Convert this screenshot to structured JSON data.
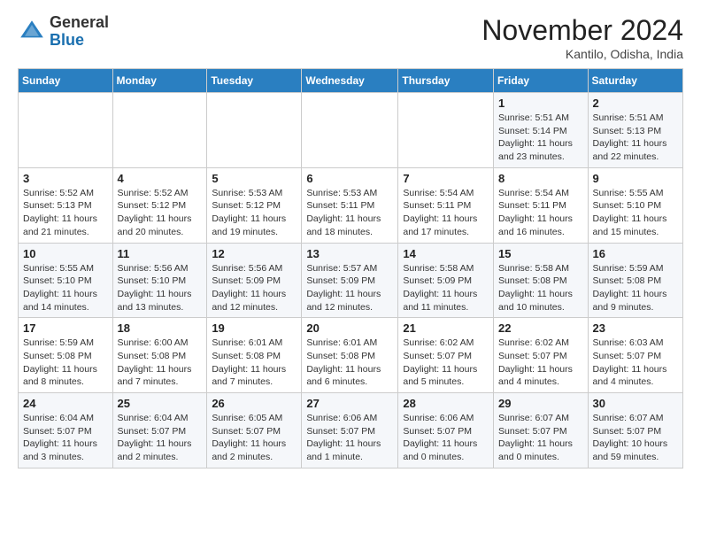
{
  "header": {
    "logo_general": "General",
    "logo_blue": "Blue",
    "month_title": "November 2024",
    "location": "Kantilo, Odisha, India"
  },
  "weekdays": [
    "Sunday",
    "Monday",
    "Tuesday",
    "Wednesday",
    "Thursday",
    "Friday",
    "Saturday"
  ],
  "weeks": [
    [
      {
        "day": "",
        "info": ""
      },
      {
        "day": "",
        "info": ""
      },
      {
        "day": "",
        "info": ""
      },
      {
        "day": "",
        "info": ""
      },
      {
        "day": "",
        "info": ""
      },
      {
        "day": "1",
        "info": "Sunrise: 5:51 AM\nSunset: 5:14 PM\nDaylight: 11 hours\nand 23 minutes."
      },
      {
        "day": "2",
        "info": "Sunrise: 5:51 AM\nSunset: 5:13 PM\nDaylight: 11 hours\nand 22 minutes."
      }
    ],
    [
      {
        "day": "3",
        "info": "Sunrise: 5:52 AM\nSunset: 5:13 PM\nDaylight: 11 hours\nand 21 minutes."
      },
      {
        "day": "4",
        "info": "Sunrise: 5:52 AM\nSunset: 5:12 PM\nDaylight: 11 hours\nand 20 minutes."
      },
      {
        "day": "5",
        "info": "Sunrise: 5:53 AM\nSunset: 5:12 PM\nDaylight: 11 hours\nand 19 minutes."
      },
      {
        "day": "6",
        "info": "Sunrise: 5:53 AM\nSunset: 5:11 PM\nDaylight: 11 hours\nand 18 minutes."
      },
      {
        "day": "7",
        "info": "Sunrise: 5:54 AM\nSunset: 5:11 PM\nDaylight: 11 hours\nand 17 minutes."
      },
      {
        "day": "8",
        "info": "Sunrise: 5:54 AM\nSunset: 5:11 PM\nDaylight: 11 hours\nand 16 minutes."
      },
      {
        "day": "9",
        "info": "Sunrise: 5:55 AM\nSunset: 5:10 PM\nDaylight: 11 hours\nand 15 minutes."
      }
    ],
    [
      {
        "day": "10",
        "info": "Sunrise: 5:55 AM\nSunset: 5:10 PM\nDaylight: 11 hours\nand 14 minutes."
      },
      {
        "day": "11",
        "info": "Sunrise: 5:56 AM\nSunset: 5:10 PM\nDaylight: 11 hours\nand 13 minutes."
      },
      {
        "day": "12",
        "info": "Sunrise: 5:56 AM\nSunset: 5:09 PM\nDaylight: 11 hours\nand 12 minutes."
      },
      {
        "day": "13",
        "info": "Sunrise: 5:57 AM\nSunset: 5:09 PM\nDaylight: 11 hours\nand 12 minutes."
      },
      {
        "day": "14",
        "info": "Sunrise: 5:58 AM\nSunset: 5:09 PM\nDaylight: 11 hours\nand 11 minutes."
      },
      {
        "day": "15",
        "info": "Sunrise: 5:58 AM\nSunset: 5:08 PM\nDaylight: 11 hours\nand 10 minutes."
      },
      {
        "day": "16",
        "info": "Sunrise: 5:59 AM\nSunset: 5:08 PM\nDaylight: 11 hours\nand 9 minutes."
      }
    ],
    [
      {
        "day": "17",
        "info": "Sunrise: 5:59 AM\nSunset: 5:08 PM\nDaylight: 11 hours\nand 8 minutes."
      },
      {
        "day": "18",
        "info": "Sunrise: 6:00 AM\nSunset: 5:08 PM\nDaylight: 11 hours\nand 7 minutes."
      },
      {
        "day": "19",
        "info": "Sunrise: 6:01 AM\nSunset: 5:08 PM\nDaylight: 11 hours\nand 7 minutes."
      },
      {
        "day": "20",
        "info": "Sunrise: 6:01 AM\nSunset: 5:08 PM\nDaylight: 11 hours\nand 6 minutes."
      },
      {
        "day": "21",
        "info": "Sunrise: 6:02 AM\nSunset: 5:07 PM\nDaylight: 11 hours\nand 5 minutes."
      },
      {
        "day": "22",
        "info": "Sunrise: 6:02 AM\nSunset: 5:07 PM\nDaylight: 11 hours\nand 4 minutes."
      },
      {
        "day": "23",
        "info": "Sunrise: 6:03 AM\nSunset: 5:07 PM\nDaylight: 11 hours\nand 4 minutes."
      }
    ],
    [
      {
        "day": "24",
        "info": "Sunrise: 6:04 AM\nSunset: 5:07 PM\nDaylight: 11 hours\nand 3 minutes."
      },
      {
        "day": "25",
        "info": "Sunrise: 6:04 AM\nSunset: 5:07 PM\nDaylight: 11 hours\nand 2 minutes."
      },
      {
        "day": "26",
        "info": "Sunrise: 6:05 AM\nSunset: 5:07 PM\nDaylight: 11 hours\nand 2 minutes."
      },
      {
        "day": "27",
        "info": "Sunrise: 6:06 AM\nSunset: 5:07 PM\nDaylight: 11 hours\nand 1 minute."
      },
      {
        "day": "28",
        "info": "Sunrise: 6:06 AM\nSunset: 5:07 PM\nDaylight: 11 hours\nand 0 minutes."
      },
      {
        "day": "29",
        "info": "Sunrise: 6:07 AM\nSunset: 5:07 PM\nDaylight: 11 hours\nand 0 minutes."
      },
      {
        "day": "30",
        "info": "Sunrise: 6:07 AM\nSunset: 5:07 PM\nDaylight: 10 hours\nand 59 minutes."
      }
    ]
  ]
}
